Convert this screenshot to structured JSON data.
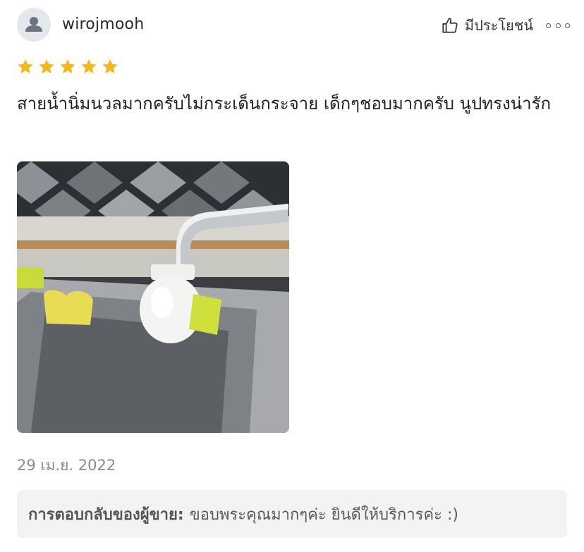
{
  "review": {
    "username": "wirojmooh",
    "helpful_label": "มีประโยชน์",
    "rating": 5,
    "text": "สายน้ำนิ่มนวลมากครับไม่กระเด็นกระจาย เด็กๆชอบมากครับ นูปทรงน่ารัก",
    "date": "29 เม.ย. 2022",
    "star_color": "#f5b81c"
  },
  "seller_reply": {
    "label": "การตอบกลับของผู้ขาย:",
    "text": "ขอบพระคุณมากๆค่ะ ยินดีให้บริการค่ะ :)"
  },
  "icons": {
    "avatar": "user-avatar-icon",
    "helpful": "thumbs-up-icon",
    "more": "more-options-icon",
    "star": "star-icon"
  }
}
